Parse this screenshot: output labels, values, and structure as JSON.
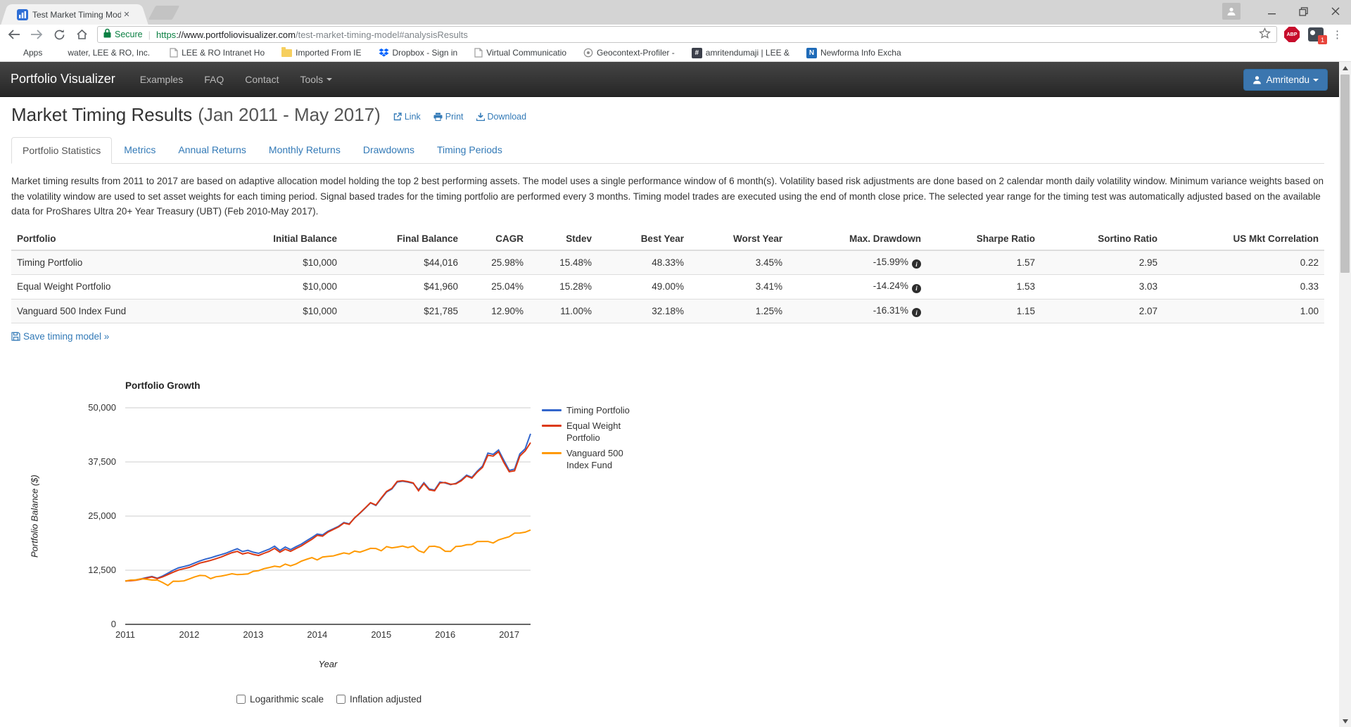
{
  "browser": {
    "tab_title": "Test Market Timing Mod",
    "secure_label": "Secure",
    "url_scheme": "https",
    "url_host": "://www.portfoliovisualizer.com",
    "url_path": "/test-market-timing-model#analysisResults",
    "abp_label": "ABP",
    "extension_badge": "1",
    "bookmarks": [
      "Apps",
      "water, LEE & RO, Inc.",
      "LEE & RO Intranet Ho",
      "Imported From IE",
      "Dropbox - Sign in",
      "Virtual Communicatio",
      "Geocontext-Profiler -",
      "amritendumaji | LEE &",
      "Newforma Info Excha"
    ]
  },
  "navbar": {
    "brand": "Portfolio Visualizer",
    "items": [
      "Examples",
      "FAQ",
      "Contact",
      "Tools"
    ],
    "user": "Amritendu"
  },
  "page": {
    "title": "Market Timing Results",
    "title_range": "(Jan 2011 - May 2017)",
    "actions": {
      "link": "Link",
      "print": "Print",
      "download": "Download"
    },
    "tabs": [
      "Portfolio Statistics",
      "Metrics",
      "Annual Returns",
      "Monthly Returns",
      "Drawdowns",
      "Timing Periods"
    ],
    "description": "Market timing results from 2011 to 2017 are based on adaptive allocation model holding the top 2 best performing assets. The model uses a single performance window of 6 month(s). Volatility based risk adjustments are done based on 2 calendar month daily volatility window. Minimum variance weights based on the volatility window are used to set asset weights for each timing period. Signal based trades for the timing portfolio are performed every 3 months. Timing model trades are executed using the end of month close price. The selected year range for the timing test was automatically adjusted based on the available data for ProShares Ultra 20+ Year Treasury (UBT) (Feb 2010-May 2017).",
    "save_link": "Save timing model »",
    "controls": {
      "log_scale": "Logarithmic scale",
      "inflation": "Inflation adjusted"
    }
  },
  "table": {
    "columns": [
      "Portfolio",
      "Initial Balance",
      "Final Balance",
      "CAGR",
      "Stdev",
      "Best Year",
      "Worst Year",
      "Max. Drawdown",
      "Sharpe Ratio",
      "Sortino Ratio",
      "US Mkt Correlation"
    ],
    "rows": [
      {
        "name": "Timing Portfolio",
        "initial": "$10,000",
        "final": "$44,016",
        "cagr": "25.98%",
        "stdev": "15.48%",
        "best": "48.33%",
        "worst": "3.45%",
        "drawdown": "-15.99%",
        "sharpe": "1.57",
        "sortino": "2.95",
        "corr": "0.22"
      },
      {
        "name": "Equal Weight Portfolio",
        "initial": "$10,000",
        "final": "$41,960",
        "cagr": "25.04%",
        "stdev": "15.28%",
        "best": "49.00%",
        "worst": "3.41%",
        "drawdown": "-14.24%",
        "sharpe": "1.53",
        "sortino": "3.03",
        "corr": "0.33"
      },
      {
        "name": "Vanguard 500 Index Fund",
        "initial": "$10,000",
        "final": "$21,785",
        "cagr": "12.90%",
        "stdev": "11.00%",
        "best": "32.18%",
        "worst": "1.25%",
        "drawdown": "-16.31%",
        "sharpe": "1.15",
        "sortino": "2.07",
        "corr": "1.00"
      }
    ]
  },
  "chart_data": {
    "type": "line",
    "title": "Portfolio Growth",
    "xlabel": "Year",
    "ylabel": "Portfolio Balance ($)",
    "x_range": "Jan 2011 - May 2017",
    "x_unit": "month",
    "ylim": [
      0,
      50000
    ],
    "grid": true,
    "legend_position": "right",
    "yticks": [
      {
        "value": 50000,
        "label": "50,000"
      },
      {
        "value": 37500,
        "label": "37,500"
      },
      {
        "value": 25000,
        "label": "25,000"
      },
      {
        "value": 12500,
        "label": "12,500"
      },
      {
        "value": 0,
        "label": "0"
      }
    ],
    "xticks": [
      {
        "month_index": 0,
        "label": "2011"
      },
      {
        "month_index": 12,
        "label": "2012"
      },
      {
        "month_index": 24,
        "label": "2013"
      },
      {
        "month_index": 36,
        "label": "2014"
      },
      {
        "month_index": 48,
        "label": "2015"
      },
      {
        "month_index": 60,
        "label": "2016"
      },
      {
        "month_index": 72,
        "label": "2017"
      }
    ],
    "series": [
      {
        "name": "Timing Portfolio",
        "color": "#3366cc",
        "values": [
          10000,
          10150,
          10280,
          10520,
          10800,
          11050,
          10650,
          11150,
          11800,
          12500,
          13050,
          13350,
          13650,
          14150,
          14650,
          15050,
          15350,
          15750,
          16100,
          16500,
          17000,
          17450,
          16800,
          17100,
          16650,
          16400,
          16900,
          17350,
          18050,
          17050,
          17850,
          17250,
          17900,
          18500,
          19300,
          20050,
          20850,
          20650,
          21500,
          22050,
          22650,
          23500,
          23200,
          24550,
          25650,
          26850,
          28050,
          27450,
          29050,
          30550,
          31250,
          32850,
          33050,
          32850,
          32550,
          31050,
          32700,
          31250,
          31000,
          32850,
          32650,
          32250,
          32550,
          33350,
          34450,
          33950,
          35350,
          36550,
          39550,
          39250,
          40250,
          37850,
          35550,
          35850,
          39350,
          40550,
          44016
        ]
      },
      {
        "name": "Equal Weight Portfolio",
        "color": "#dc3912",
        "values": [
          10000,
          10080,
          10180,
          10430,
          10700,
          10950,
          10550,
          10950,
          11500,
          12050,
          12550,
          12850,
          13150,
          13650,
          14150,
          14450,
          14750,
          15150,
          15550,
          16050,
          16550,
          16850,
          16250,
          16550,
          16150,
          15900,
          16400,
          16850,
          17550,
          16650,
          17350,
          16850,
          17500,
          18100,
          18900,
          19650,
          20550,
          20350,
          21300,
          21900,
          22500,
          23400,
          23100,
          24600,
          25700,
          26900,
          28100,
          27550,
          29150,
          30700,
          31400,
          33000,
          33150,
          32950,
          32650,
          30850,
          32500,
          31050,
          30850,
          32650,
          32750,
          32350,
          32450,
          33150,
          34250,
          33750,
          35150,
          36250,
          39050,
          38850,
          39850,
          37350,
          35250,
          35450,
          38850,
          40050,
          41960
        ]
      },
      {
        "name": "Vanguard 500 Index Fund",
        "color": "#ff9900",
        "values": [
          10000,
          10230,
          10240,
          10530,
          10400,
          10230,
          10220,
          9660,
          8980,
          9960,
          9940,
          10040,
          10490,
          10940,
          11300,
          11230,
          10560,
          10990,
          11140,
          11390,
          11690,
          11470,
          11540,
          11640,
          12240,
          12400,
          12860,
          13110,
          13420,
          13240,
          13910,
          13510,
          13930,
          14570,
          15020,
          15400,
          14870,
          15550,
          15680,
          15790,
          16160,
          16500,
          16270,
          16920,
          16680,
          17090,
          17550,
          17510,
          16980,
          17960,
          17670,
          17840,
          18070,
          17720,
          18090,
          17000,
          16580,
          17980,
          18030,
          17750,
          16870,
          16850,
          17990,
          18060,
          18380,
          18430,
          19110,
          19140,
          19140,
          18790,
          19490,
          19870,
          20250,
          21050,
          21080,
          21290,
          21785
        ]
      }
    ]
  }
}
